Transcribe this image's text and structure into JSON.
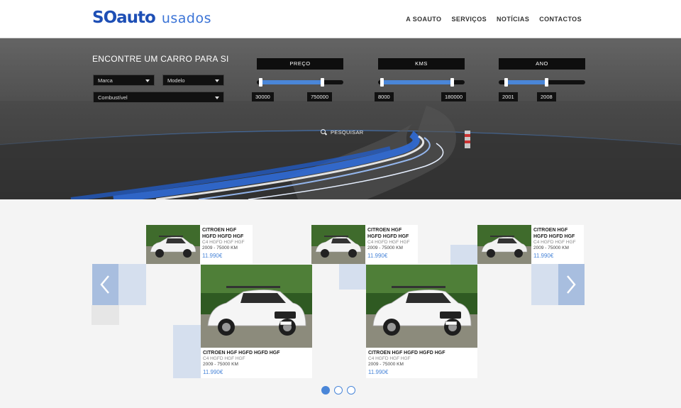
{
  "header": {
    "logo_brand": "SOauto",
    "logo_sub": "usados",
    "nav": [
      "A SOAUTO",
      "SERVIÇOS",
      "NOTÍCIAS",
      "CONTACTOS"
    ]
  },
  "search": {
    "title": "ENCONTRE UM CARRO PARA SI",
    "brand_dropdown": "Marca",
    "model_dropdown": "Modelo",
    "fuel_dropdown": "Combustível",
    "button": "PESQUISAR",
    "filters": [
      {
        "label": "PREÇO",
        "min": "30000",
        "max": "750000",
        "fill_start": 0.04,
        "fill_end": 0.75
      },
      {
        "label": "KMS",
        "min": "8000",
        "max": "180000",
        "fill_start": 0.04,
        "fill_end": 0.85
      },
      {
        "label": "ANO",
        "min": "2001",
        "max": "2008",
        "fill_start": 0.08,
        "fill_end": 0.55
      }
    ]
  },
  "listings": {
    "small": [
      {
        "title": "CITROEN HGF HGFD HGFD HGF",
        "model": "C4 HGFD HGF HGF",
        "meta": "2009 - 75000 KM",
        "price": "11.990€"
      },
      {
        "title": "CITROEN HGF HGFD HGFD HGF",
        "model": "C4 HGFD HGF HGF",
        "meta": "2009 - 75000 KM",
        "price": "11.990€"
      },
      {
        "title": "CITROEN HGF HGFD HGFD HGF",
        "model": "C4 HGFD HGF HGF",
        "meta": "2009 - 75000 KM",
        "price": "11.990€"
      }
    ],
    "big": [
      {
        "title": "CITROEN HGF HGFD HGFD HGF",
        "model": "C4 HGFD HGF HGF",
        "meta": "2009 - 75000 KM",
        "price": "11.990€"
      },
      {
        "title": "CITROEN HGF HGFD HGFD HGF",
        "model": "C4 HGFD HGF HGF",
        "meta": "2009 - 75000 KM",
        "price": "11.990€"
      }
    ]
  },
  "pagination": {
    "pages": 3,
    "active": 1
  },
  "colors": {
    "accent": "#4a86d8",
    "brand": "#1e4fb5"
  }
}
